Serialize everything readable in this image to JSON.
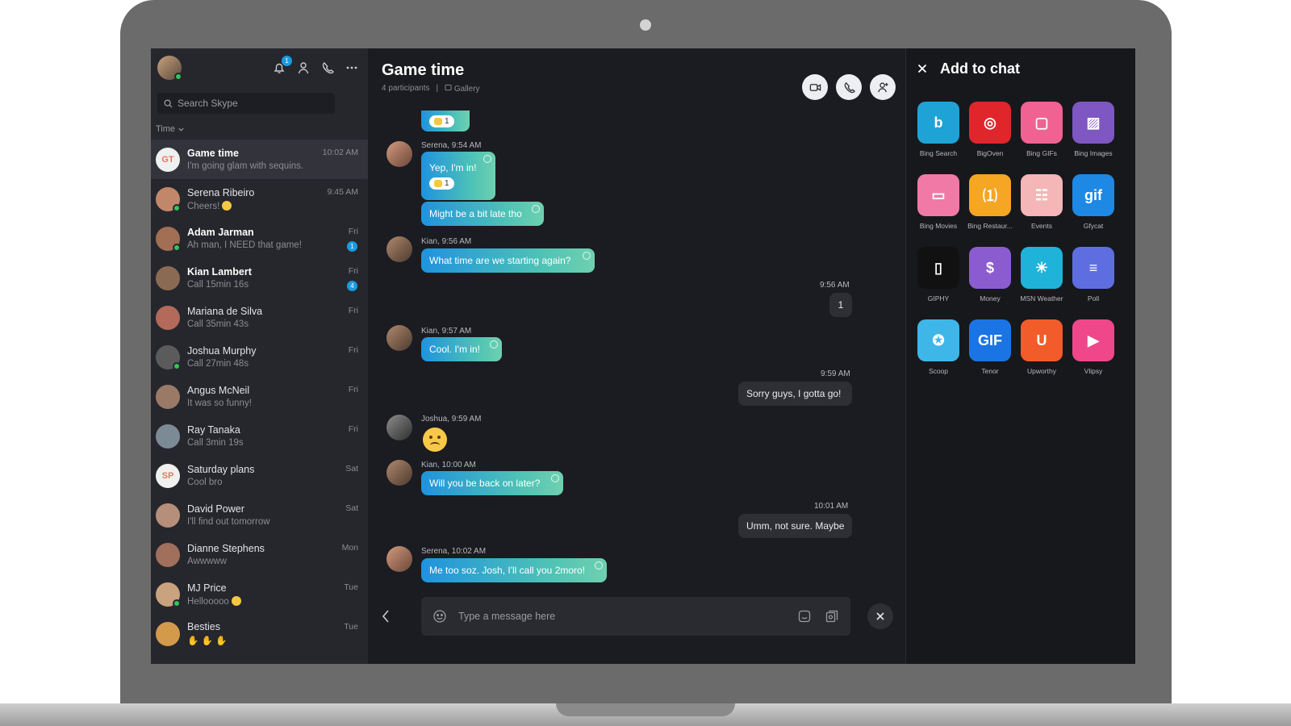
{
  "sidebar": {
    "notification_count": "1",
    "search_placeholder": "Search Skype",
    "sort_label": "Time",
    "conversations": [
      {
        "initials": "GT",
        "name": "Game time",
        "preview": "I'm going glam with sequins.",
        "time": "10:02 AM",
        "bold": true,
        "active": true,
        "avatar_color": "#f0f0f0",
        "initials_color": "#e8765f"
      },
      {
        "name": "Serena Ribeiro",
        "preview": "Cheers!",
        "time": "9:45 AM",
        "avatar_color": "#c2876a",
        "online": true,
        "emoji": true
      },
      {
        "name": "Adam Jarman",
        "preview": "Ah man, I NEED that game!",
        "time": "Fri",
        "bold": true,
        "unread": "1",
        "avatar_color": "#a26f55",
        "online": true
      },
      {
        "name": "Kian Lambert",
        "preview": "Call 15min 16s",
        "time": "Fri",
        "bold": true,
        "unread": "4",
        "avatar_color": "#8a6a52"
      },
      {
        "name": "Mariana de Silva",
        "preview": "Call 35min 43s",
        "time": "Fri",
        "avatar_color": "#b36a5a"
      },
      {
        "name": "Joshua Murphy",
        "preview": "Call 27min 48s",
        "time": "Fri",
        "avatar_color": "#5b5b5b",
        "online": true
      },
      {
        "name": "Angus McNeil",
        "preview": "It was so funny!",
        "time": "Fri",
        "avatar_color": "#9a7a66"
      },
      {
        "name": "Ray Tanaka",
        "preview": "Call 3min 19s",
        "time": "Fri",
        "avatar_color": "#7c8a96"
      },
      {
        "initials": "SP",
        "name": "Saturday plans",
        "preview": "Cool bro",
        "time": "Sat",
        "avatar_color": "#f0f0f0",
        "initials_color": "#e8765f"
      },
      {
        "name": "David Power",
        "preview": "I'll find out tomorrow",
        "time": "Sat",
        "avatar_color": "#b58f79"
      },
      {
        "name": "Dianne Stephens",
        "preview": "Awwwww",
        "time": "Mon",
        "avatar_color": "#a0705c"
      },
      {
        "name": "MJ Price",
        "preview": "Hellooooo",
        "time": "Tue",
        "avatar_color": "#c9a27e",
        "online": true,
        "emoji": true
      },
      {
        "name": "Besties",
        "preview": "",
        "time": "Tue",
        "avatar_color": "#d49a4c",
        "preview_hands": true
      }
    ]
  },
  "chat": {
    "title": "Game time",
    "participants": "4 participants",
    "separator": "|",
    "gallery": "Gallery",
    "reaction_count": "1",
    "messages": {
      "serena1_label": "Serena, 9:54 AM",
      "serena1_text": "Yep, I'm in!",
      "serena2_text": "Might be a bit late tho",
      "kian1_label": "Kian, 9:56 AM",
      "kian1_text": "What time are we starting again?",
      "out1_time": "9:56 AM",
      "out1_text": "1",
      "kian2_label": "Kian, 9:57 AM",
      "kian2_text": "Cool. I'm in!",
      "out2_time": "9:59 AM",
      "out2_text": "Sorry guys, I gotta go!",
      "joshua_label": "Joshua, 9:59 AM",
      "kian3_label": "Kian, 10:00 AM",
      "kian3_text": "Will you be back on later?",
      "out3_time": "10:01 AM",
      "out3_text": "Umm, not sure. Maybe",
      "serena3_label": "Serena, 10:02 AM",
      "serena3_text": "Me too soz. Josh, I'll call you 2moro!"
    },
    "composer_placeholder": "Type a message here"
  },
  "panel": {
    "title": "Add to chat",
    "apps": [
      {
        "label": "Bing Search",
        "glyph": "b",
        "color": "#1fa3d6"
      },
      {
        "label": "BigOven",
        "glyph": "◎",
        "color": "#e0262b"
      },
      {
        "label": "Bing GIFs",
        "glyph": "▢",
        "color": "#f06292"
      },
      {
        "label": "Bing Images",
        "glyph": "▨",
        "color": "#7e57c2"
      },
      {
        "label": "Bing Movies",
        "glyph": "▭",
        "color": "#f07aa5"
      },
      {
        "label": "Bing Restaur...",
        "glyph": "⑴",
        "color": "#f5a623"
      },
      {
        "label": "Events",
        "glyph": "☷",
        "color": "#f4b6b6"
      },
      {
        "label": "Gfycat",
        "glyph": "gif",
        "color": "#1e88e5"
      },
      {
        "label": "GIPHY",
        "glyph": "▯",
        "color": "#111111"
      },
      {
        "label": "Money",
        "glyph": "$",
        "color": "#8a5cd0"
      },
      {
        "label": "MSN Weather",
        "glyph": "☀",
        "color": "#20b3d9"
      },
      {
        "label": "Poll",
        "glyph": "≡",
        "color": "#5e6ee0"
      },
      {
        "label": "Scoop",
        "glyph": "✪",
        "color": "#3fb6e8"
      },
      {
        "label": "Tenor",
        "glyph": "GIF",
        "color": "#1b74e4"
      },
      {
        "label": "Upworthy",
        "glyph": "U",
        "color": "#f25c2a"
      },
      {
        "label": "Vlipsy",
        "glyph": "▶",
        "color": "#f0478a"
      }
    ]
  }
}
